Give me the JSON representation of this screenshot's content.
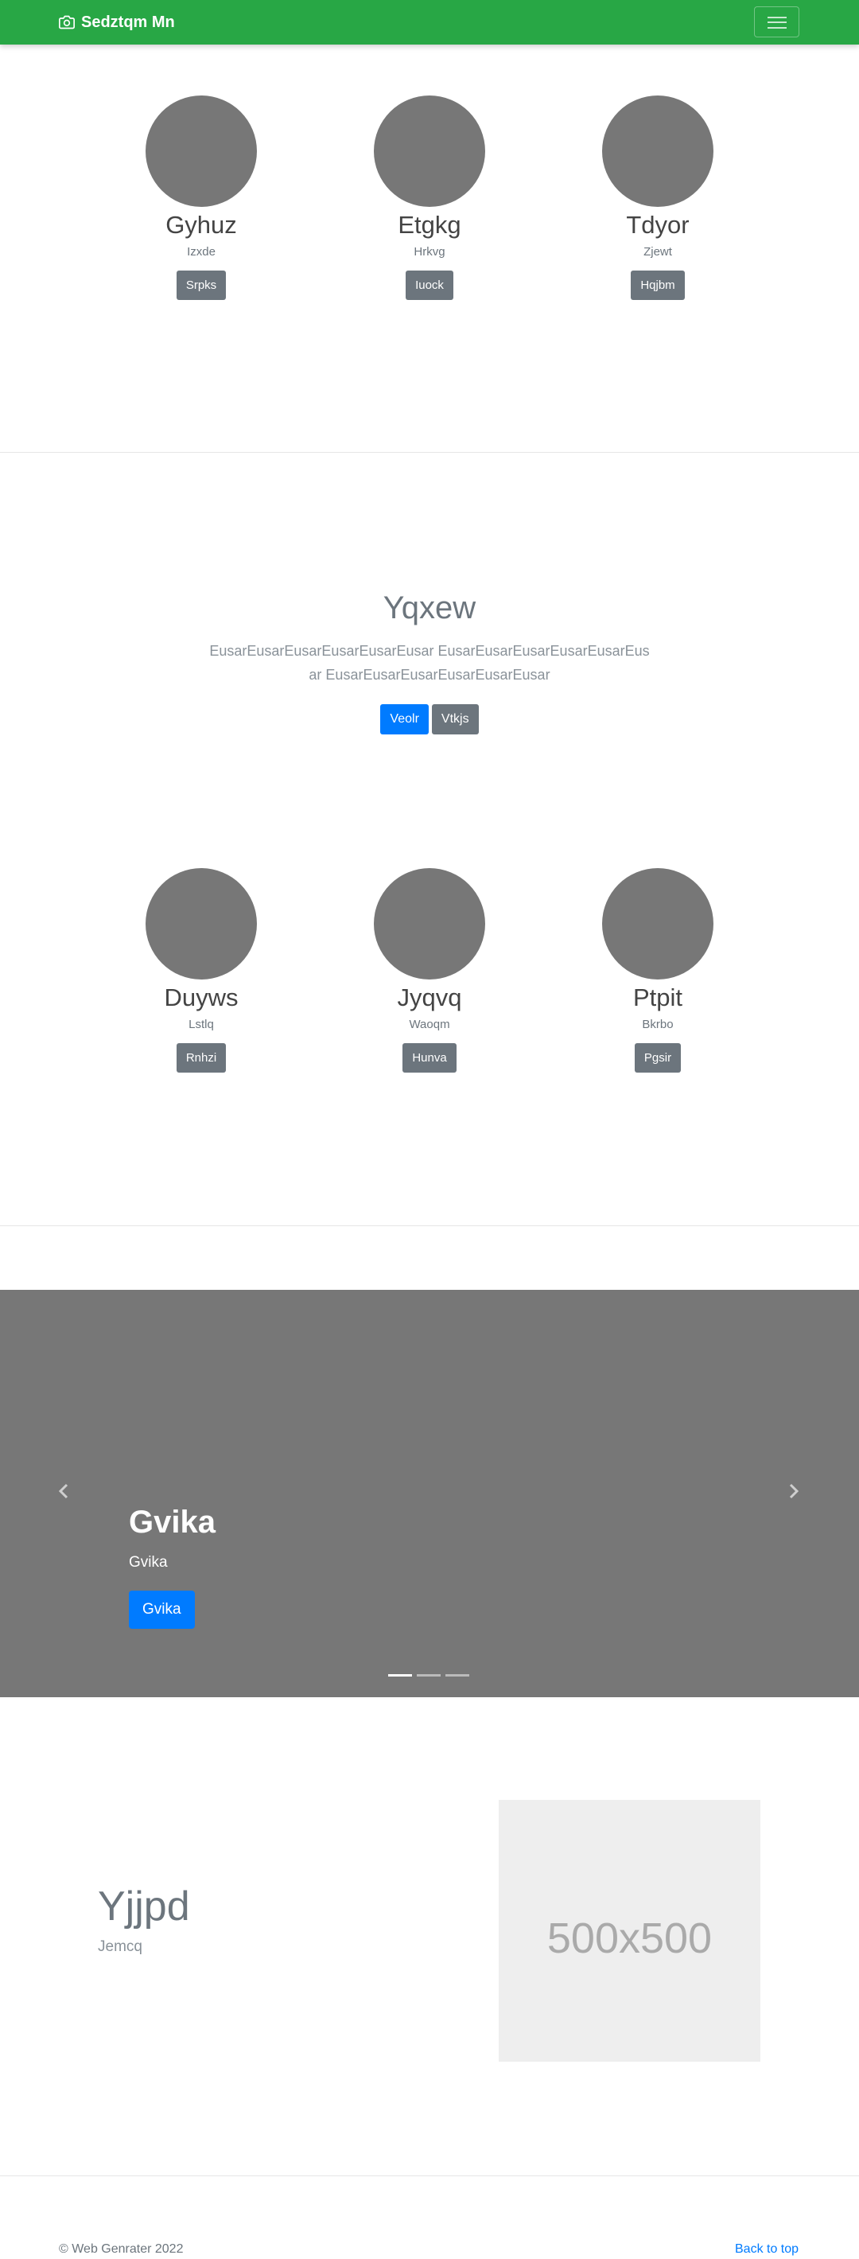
{
  "navbar": {
    "brand": "Sedztqm Mn",
    "brand_icon": "camera-icon",
    "toggler_icon": "hamburger-icon",
    "bg_color": "#28a745"
  },
  "profiles_top": [
    {
      "name": "Gyhuz",
      "sub": "Izxde",
      "button": "Srpks"
    },
    {
      "name": "Etgkg",
      "sub": "Hrkvg",
      "button": "Iuock"
    },
    {
      "name": "Tdyor",
      "sub": "Zjewt",
      "button": "Hqjbm"
    }
  ],
  "hero": {
    "title": "Yqxew",
    "text": "EusarEusarEusarEusarEusarEusar EusarEusarEusarEusarEusarEusar EusarEusarEusarEusarEusarEusar",
    "primary_button": "Veolr",
    "secondary_button": "Vtkjs"
  },
  "profiles_bottom": [
    {
      "name": "Duyws",
      "sub": "Lstlq",
      "button": "Rnhzi"
    },
    {
      "name": "Jyqvq",
      "sub": "Waoqm",
      "button": "Hunva"
    },
    {
      "name": "Ptpit",
      "sub": "Bkrbo",
      "button": "Pgsir"
    }
  ],
  "carousel": {
    "title": "Gvika",
    "subtitle": "Gvika",
    "button": "Gvika",
    "prev_icon": "chevron-left-icon",
    "next_icon": "chevron-right-icon",
    "active_slide": 1,
    "slide_count": 3
  },
  "feature": {
    "title": "Yjjpd",
    "subtitle": "Jemcq",
    "placeholder_text": "500x500"
  },
  "footer": {
    "copyright": "© Web Genrater 2022",
    "back_to_top": "Back to top"
  },
  "colors": {
    "primary": "#007bff",
    "secondary": "#6c757d",
    "navbar": "#28a745",
    "placeholder_gray": "#777777"
  }
}
